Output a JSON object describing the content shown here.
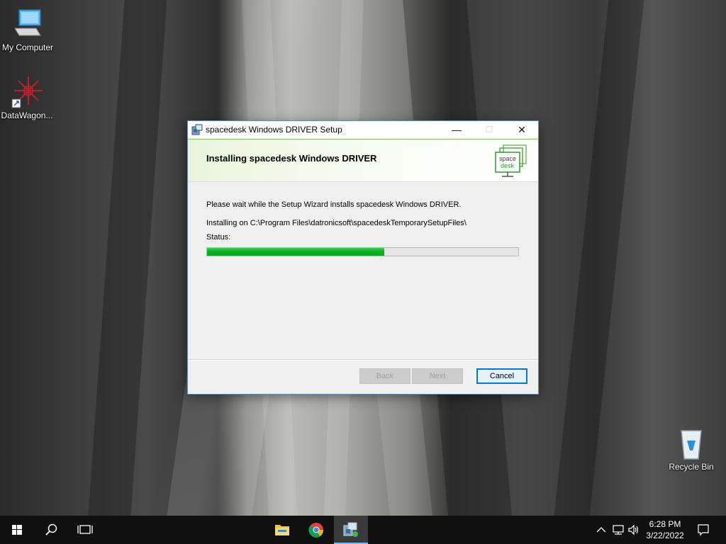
{
  "desktop": {
    "icons": [
      {
        "label": "My Computer"
      },
      {
        "label": "DataWagon..."
      },
      {
        "label": "Recycle Bin"
      }
    ]
  },
  "window": {
    "title": "spacedesk Windows DRIVER Setup",
    "controls": {
      "minimize": "—",
      "maximize": "☐",
      "close": "✕"
    },
    "banner": {
      "heading": "Installing spacedesk Windows DRIVER",
      "logo_text_line1": "space",
      "logo_text_line2": "desk"
    },
    "message": "Please wait while the Setup Wizard installs spacedesk Windows DRIVER.",
    "installing_on": "Installing on C:\\Program Files\\datronicsoft\\spacedeskTemporarySetupFiles\\",
    "status_label": "Status:",
    "progress_fraction": 0.57,
    "buttons": {
      "back": "Back",
      "next": "Next",
      "cancel": "Cancel"
    }
  },
  "taskbar": {
    "time": "6:28 PM",
    "date": "3/22/2022"
  },
  "colors": {
    "progress_green": "#06b025",
    "taskbar": "#101010",
    "accent": "#0078d7"
  }
}
